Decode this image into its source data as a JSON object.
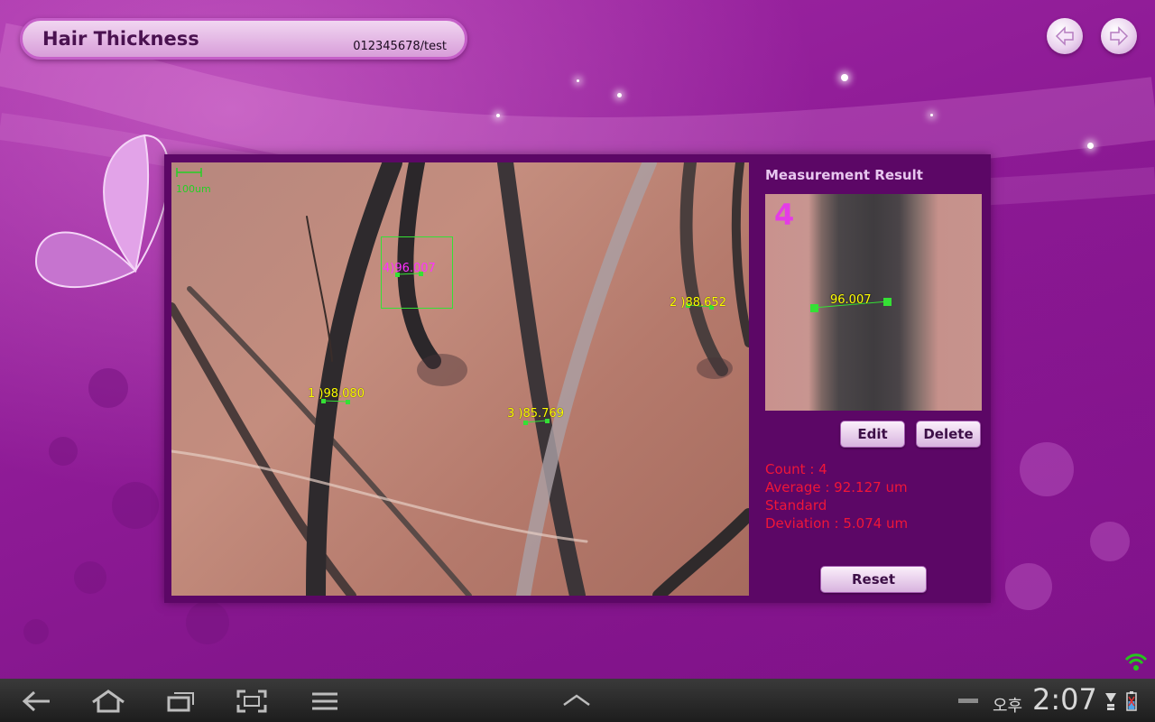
{
  "header": {
    "title": "Hair Thickness",
    "subtitle": "012345678/test"
  },
  "nav": {
    "back_icon": "arrow-left-icon",
    "forward_icon": "arrow-right-icon"
  },
  "image": {
    "scale_label": "100um",
    "measurements": [
      {
        "label": "1 )98.080"
      },
      {
        "label": "2 )88.652"
      },
      {
        "label": "3 )85.769"
      },
      {
        "label": "4)96.007"
      }
    ]
  },
  "result": {
    "title": "Measurement Result",
    "zoom_number": "4",
    "zoom_value": "96.007",
    "edit_label": "Edit",
    "delete_label": "Delete",
    "count": "Count : 4",
    "average": "Average : 92.127 um",
    "std_line1": "Standard",
    "std_line2": "Deviation : 5.074 um",
    "reset_label": "Reset"
  },
  "system_bar": {
    "ampm": "오후",
    "time": "2:07"
  },
  "colors": {
    "background": "#8d1a95",
    "panel": "#5c0766",
    "measure_text": "#ffff00",
    "selected_text": "#ff30ff",
    "stats_text": "#f01638",
    "marker": "#35e035"
  }
}
